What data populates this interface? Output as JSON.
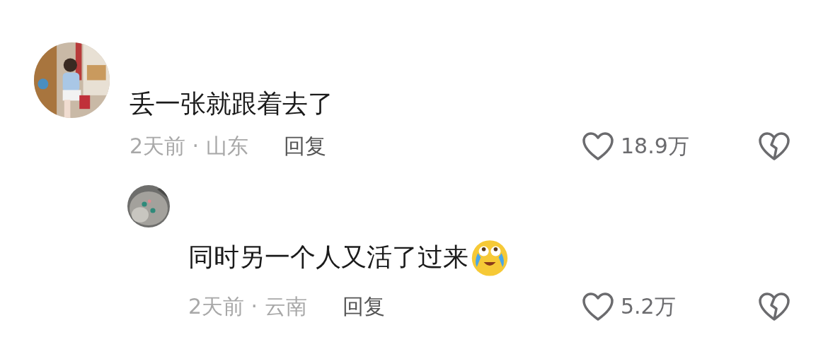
{
  "comments": [
    {
      "kind": "comment",
      "text": "丢一张就跟着去了",
      "meta": "2天前 · 山东",
      "reply_label": "回复",
      "likes": "18.9万"
    },
    {
      "kind": "reply",
      "text": "同时另一个人又活了过来",
      "emoji": true,
      "meta": "2天前 · 云南",
      "reply_label": "回复",
      "likes": "5.2万"
    }
  ]
}
